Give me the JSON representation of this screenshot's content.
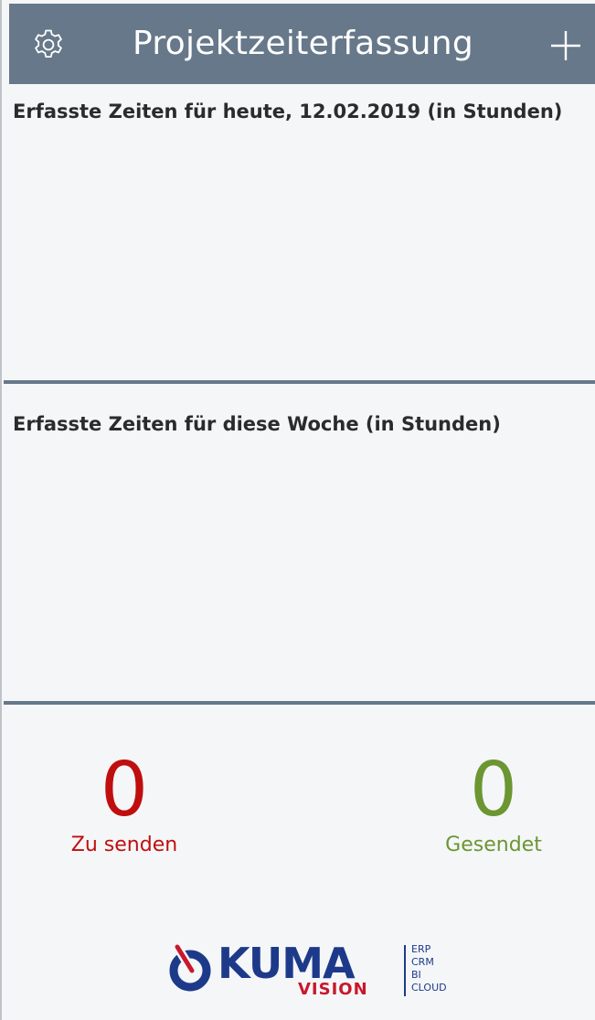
{
  "header": {
    "title": "Projektzeiterfassung",
    "settings_icon": "gear-icon",
    "add_icon": "plus-icon",
    "background": "#667889"
  },
  "sections": {
    "today": {
      "heading": "Erfasste Zeiten für heute, 12.02.2019 (in Stunden)"
    },
    "week": {
      "heading": "Erfasste Zeiten für diese Woche (in Stunden)"
    }
  },
  "counters": {
    "pending": {
      "value": "0",
      "label": "Zu senden",
      "color": "#c00e0e"
    },
    "sent": {
      "value": "0",
      "label": "Gesendet",
      "color": "#6b9632"
    }
  },
  "logo": {
    "word": "KUMA",
    "sub": "VISION",
    "tags": [
      "ERP",
      "CRM",
      "BI",
      "CLOUD"
    ],
    "brand_blue": "#1d3a8a",
    "brand_red": "#c8182b"
  }
}
